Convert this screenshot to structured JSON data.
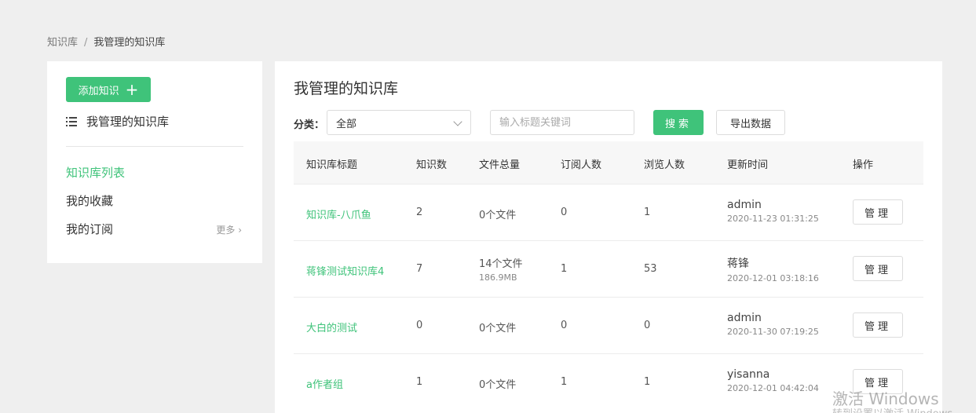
{
  "breadcrumb": {
    "root": "知识库",
    "separator": "/",
    "current": "我管理的知识库"
  },
  "sidebar": {
    "add_button": "添加知识",
    "add_icon": "+",
    "my_library": "我管理的知识库",
    "nav": [
      {
        "label": "知识库列表"
      },
      {
        "label": "我的收藏"
      },
      {
        "label": "我的订阅"
      }
    ],
    "more": "更多 ›"
  },
  "main": {
    "title": "我管理的知识库",
    "filter_label": "分类：",
    "category_selected": "全部",
    "search_placeholder": "输入标题关键词",
    "search_button": "搜索",
    "export_button": "导出数据"
  },
  "table": {
    "headers": [
      "知识库标题",
      "知识数",
      "文件总量",
      "订阅人数",
      "浏览人数",
      "更新时间",
      "操作"
    ],
    "rows": [
      {
        "title": "知识库-八爪鱼",
        "count": "2",
        "files": "0个文件",
        "size": "",
        "subs": "0",
        "views": "1",
        "user": "admin",
        "time": "2020-11-23 01:31:25",
        "action": "管理"
      },
      {
        "title": "蒋锋测试知识库4",
        "count": "7",
        "files": "14个文件",
        "size": "186.9MB",
        "subs": "1",
        "views": "53",
        "user": "蒋锋",
        "time": "2020-12-01 03:18:16",
        "action": "管理"
      },
      {
        "title": "大白的测试",
        "count": "0",
        "files": "0个文件",
        "size": "",
        "subs": "0",
        "views": "0",
        "user": "admin",
        "time": "2020-11-30 07:19:25",
        "action": "管理"
      },
      {
        "title": "a作者组",
        "count": "1",
        "files": "0个文件",
        "size": "",
        "subs": "1",
        "views": "1",
        "user": "yisanna",
        "time": "2020-12-01 04:42:04",
        "action": "管理"
      }
    ]
  },
  "watermark": {
    "line1": "激活 Windows",
    "line2": "转到设置以激活 Windows"
  },
  "colors": {
    "accent": "#3fc37a",
    "background": "#efefef"
  }
}
